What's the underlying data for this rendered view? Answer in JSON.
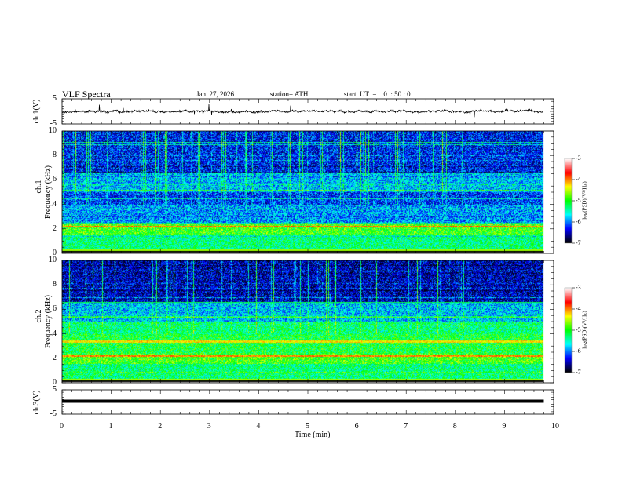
{
  "header": {
    "title": "VLF Spectra",
    "date": "Jan. 27, 2026",
    "station": "station= ATH",
    "start": "start  UT  =    0  : 50 : 0"
  },
  "chart_data": [
    {
      "type": "line",
      "panel": "ch1 waveform",
      "ylabel": "ch.1(V)",
      "yticks": [
        "5",
        "-5"
      ],
      "ylim": [
        -5,
        5
      ],
      "xlim": [
        0,
        10
      ],
      "color": "#000000"
    },
    {
      "type": "heatmap",
      "panel": "ch1 spectrogram",
      "ylabel": "ch.1\nFrequency (kHz)",
      "ylabel_lines": [
        "ch.1",
        "Frequency  (kHz)"
      ],
      "yticks": [
        "10",
        "8",
        "6",
        "4",
        "2",
        "0"
      ],
      "ylim": [
        0,
        10
      ],
      "xlim": [
        0,
        10
      ],
      "data_xmax": 9.8,
      "colorbar": {
        "label": "log(PSD)(V²/Hz)",
        "ticks": [
          "-3",
          "-4",
          "-5",
          "-6",
          "-7"
        ],
        "range": [
          -7,
          -3
        ],
        "colormap": [
          "#000000",
          "#0000ff",
          "#00ffff",
          "#00ff00",
          "#ffff00",
          "#ff0000",
          "#ffffff"
        ]
      }
    },
    {
      "type": "heatmap",
      "panel": "ch2 spectrogram",
      "ylabel_lines": [
        "ch.2",
        "Frequency  (kHz)"
      ],
      "yticks": [
        "10",
        "8",
        "6",
        "4",
        "2",
        "0"
      ],
      "ylim": [
        0,
        10
      ],
      "xlim": [
        0,
        10
      ],
      "data_xmax": 9.8,
      "colorbar": {
        "label": "log(PSD)(V²/Hz)",
        "ticks": [
          "-3",
          "-4",
          "-5",
          "-6",
          "-7"
        ],
        "range": [
          -7,
          -3
        ]
      }
    },
    {
      "type": "line",
      "panel": "ch3 waveform",
      "ylabel": "ch.3(V)",
      "yticks": [
        "5",
        "-5"
      ],
      "ylim": [
        -5,
        5
      ],
      "xlim": [
        0,
        10
      ],
      "value": 0
    }
  ],
  "xaxis": {
    "label": "Time  (min)",
    "ticks": [
      "0",
      "1",
      "2",
      "3",
      "4",
      "5",
      "6",
      "7",
      "8",
      "9",
      "10"
    ]
  }
}
